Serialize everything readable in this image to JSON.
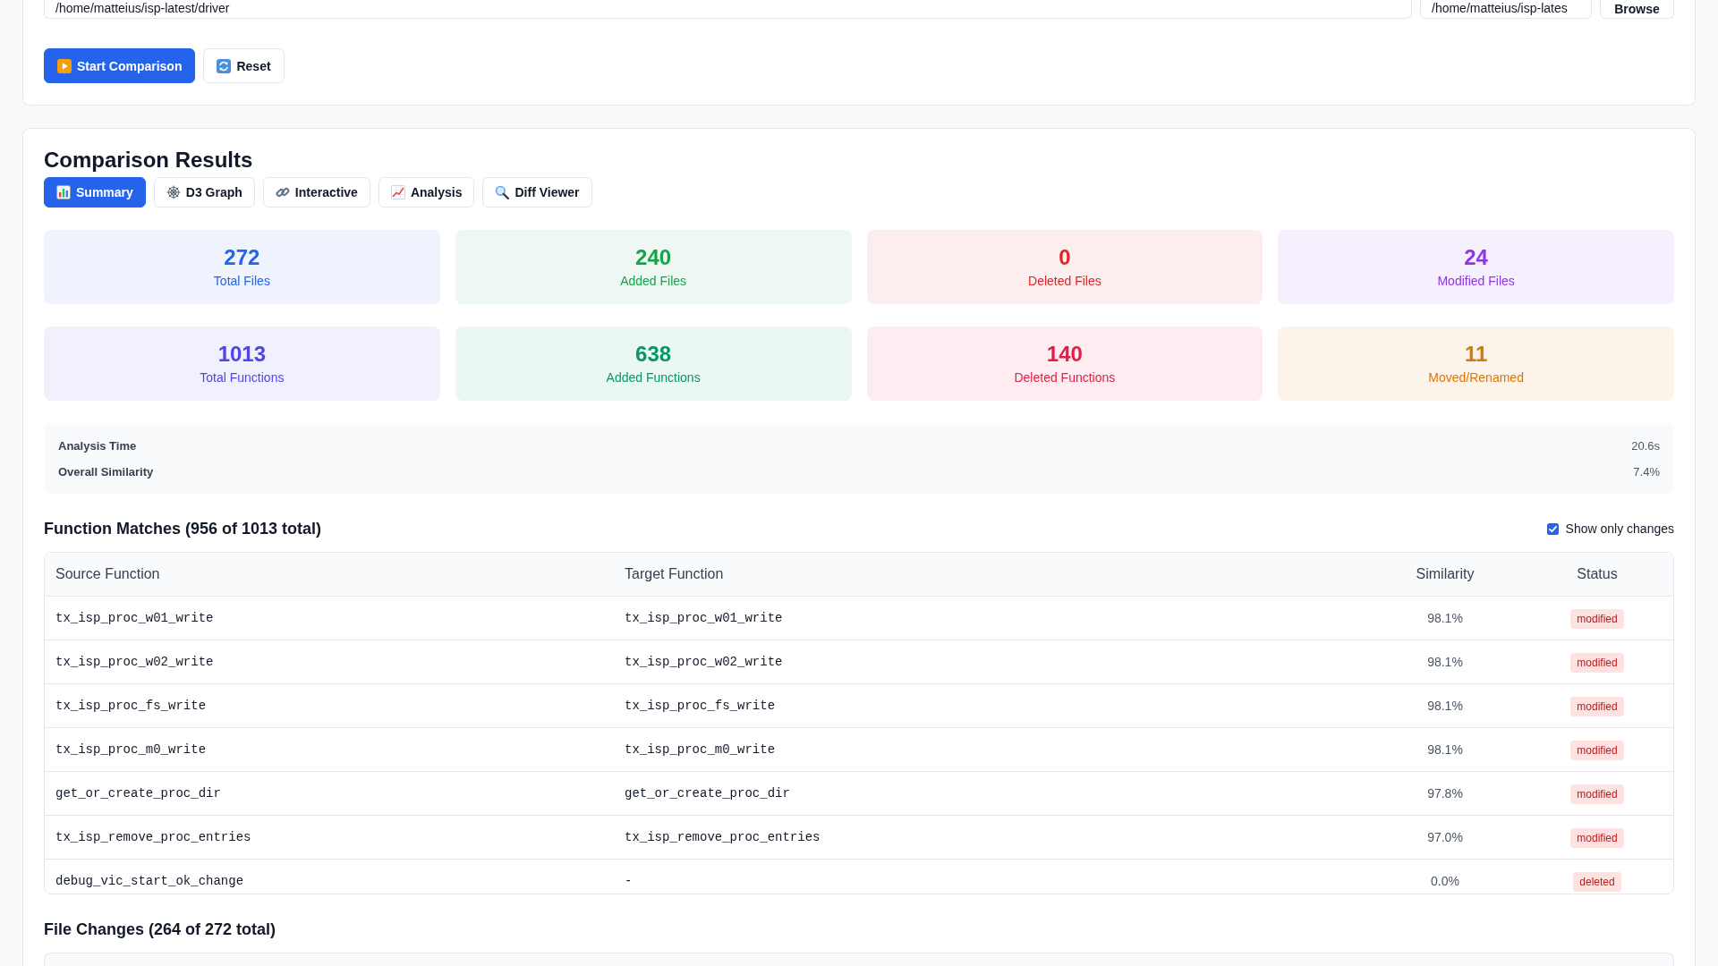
{
  "form": {
    "source_path": "/home/matteius/isp-latest/driver",
    "target_path": "/home/matteius/isp-lates",
    "browse_button": "Browse",
    "actions": [
      {
        "label": "Start Comparison",
        "kind": "primary"
      },
      {
        "label": "Reset",
        "kind": "secondary"
      }
    ]
  },
  "results": {
    "title": "Comparison Results",
    "tabs": [
      {
        "label": "Summary",
        "selected": true
      },
      {
        "label": "D3 Graph",
        "selected": false
      },
      {
        "label": "Interactive",
        "selected": false
      },
      {
        "label": "Analysis",
        "selected": false
      },
      {
        "label": "Diff Viewer",
        "selected": false
      }
    ],
    "stats": [
      {
        "value": "272",
        "label": "Total Files",
        "color": "#2563eb"
      },
      {
        "value": "240",
        "label": "Added Files",
        "color": "#16a34a"
      },
      {
        "value": "0",
        "label": "Deleted Files",
        "color": "#dc2626"
      },
      {
        "value": "24",
        "label": "Modified Files",
        "color": "#9333ea"
      },
      {
        "value": "1013",
        "label": "Total Functions",
        "color": "#4f46e5"
      },
      {
        "value": "638",
        "label": "Added Functions",
        "color": "#059669"
      },
      {
        "value": "140",
        "label": "Deleted Functions",
        "color": "#e11d48"
      },
      {
        "value": "11",
        "label": "Moved/Renamed",
        "color": "#d97706"
      }
    ],
    "info": [
      {
        "label": "Analysis Time",
        "value": "20.6s"
      },
      {
        "label": "Overall Similarity",
        "value": "7.4%"
      }
    ],
    "function_matches": {
      "title": "Function Matches (956 of 1013 total)",
      "show_only_changes": {
        "label": "Show only changes",
        "checked": true
      },
      "columns": [
        "Source Function",
        "Target Function",
        "Similarity",
        "Status"
      ],
      "rows": [
        {
          "source": "tx_isp_proc_w01_write",
          "target": "tx_isp_proc_w01_write",
          "similarity": "98.1%",
          "status": "modified"
        },
        {
          "source": "tx_isp_proc_w02_write",
          "target": "tx_isp_proc_w02_write",
          "similarity": "98.1%",
          "status": "modified"
        },
        {
          "source": "tx_isp_proc_fs_write",
          "target": "tx_isp_proc_fs_write",
          "similarity": "98.1%",
          "status": "modified"
        },
        {
          "source": "tx_isp_proc_m0_write",
          "target": "tx_isp_proc_m0_write",
          "similarity": "98.1%",
          "status": "modified"
        },
        {
          "source": "get_or_create_proc_dir",
          "target": "get_or_create_proc_dir",
          "similarity": "97.8%",
          "status": "modified"
        },
        {
          "source": "tx_isp_remove_proc_entries",
          "target": "tx_isp_remove_proc_entries",
          "similarity": "97.0%",
          "status": "modified"
        },
        {
          "source": "debug_vic_start_ok_change",
          "target": "-",
          "similarity": "0.0%",
          "status": "deleted"
        }
      ]
    },
    "file_changes": {
      "title": "File Changes (264 of 272 total)"
    }
  }
}
